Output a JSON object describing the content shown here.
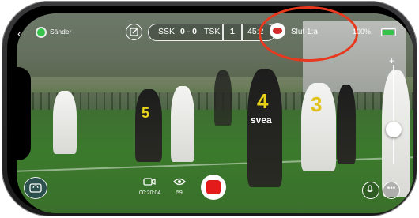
{
  "status_bar": {
    "back_icon": "chevron-left-icon",
    "live_label": "Sänder",
    "battery_percent": "100%",
    "battery_color": "#36c24b"
  },
  "scoreboard": {
    "home_team": "SSK",
    "score": "0 - 0",
    "away_team": "TSK",
    "period": "1",
    "clock": "45:2",
    "status": "Slut 1:a",
    "team_logo_color": "#d42b2b"
  },
  "controls": {
    "duration": "00:20:04",
    "viewers": "59",
    "record_color": "#e31b1b",
    "zoom_label": "+"
  },
  "jerseys": {
    "front_black": "4",
    "white_center": "3",
    "black_left": "5",
    "sponsor": "svea"
  },
  "highlight_color": "#e8391f"
}
